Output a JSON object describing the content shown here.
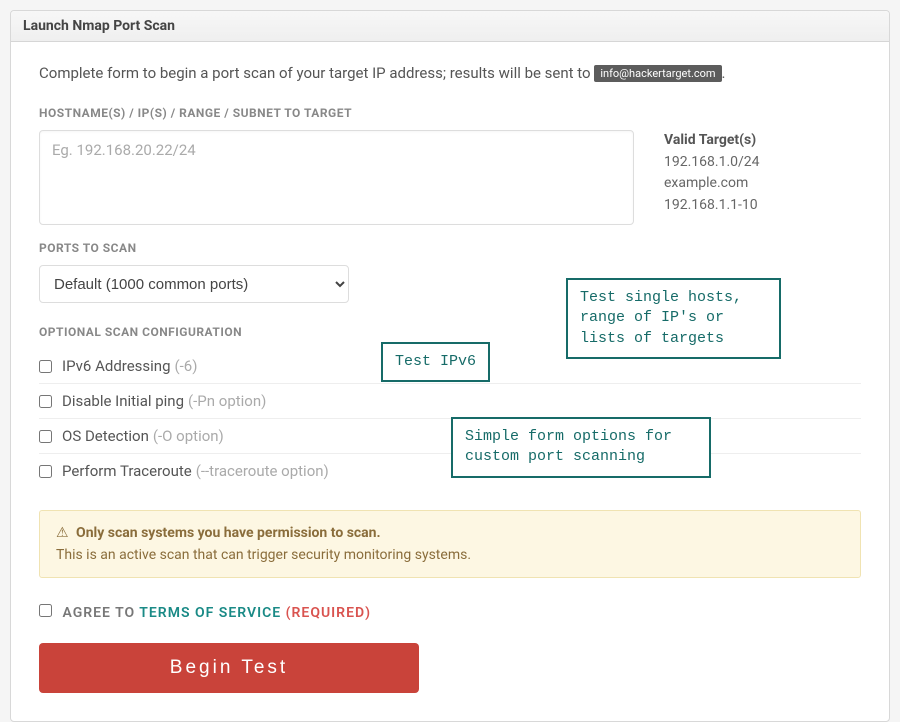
{
  "header": {
    "title": "Launch Nmap Port Scan"
  },
  "intro": {
    "text_before": "Complete form to begin a port scan of your target IP address; results will be sent to ",
    "email": "info@hackertarget.com",
    "text_after": "."
  },
  "targets": {
    "label": "HOSTNAME(S) / IP(S) / RANGE / SUBNET TO TARGET",
    "placeholder": "Eg. 192.168.20.22/24",
    "value": "",
    "valid_title": "Valid Target(s)",
    "valid_examples": [
      "192.168.1.0/24",
      "example.com",
      "192.168.1.1-10"
    ]
  },
  "ports": {
    "label": "PORTS TO SCAN",
    "selected": "Default (1000 common ports)"
  },
  "optional": {
    "label": "OPTIONAL SCAN CONFIGURATION",
    "items": [
      {
        "label": "IPv6 Addressing",
        "hint": "(-6)"
      },
      {
        "label": "Disable Initial ping",
        "hint": "(-Pn option)"
      },
      {
        "label": "OS Detection",
        "hint": "(-O option)"
      },
      {
        "label": "Perform Traceroute",
        "hint": "(--traceroute option)"
      }
    ]
  },
  "alert": {
    "title": "Only scan systems you have permission to scan.",
    "body": "This is an active scan that can trigger security monitoring systems."
  },
  "agree": {
    "label": "AGREE TO ",
    "tos": "TERMS OF SERVICE",
    "required": " (REQUIRED)"
  },
  "submit": {
    "label": "Begin Test"
  },
  "annotations": {
    "targets": "Test single hosts,\nrange of IP's or\nlists of targets",
    "ipv6": "Test IPv6",
    "options": "Simple form options for\ncustom port scanning"
  }
}
